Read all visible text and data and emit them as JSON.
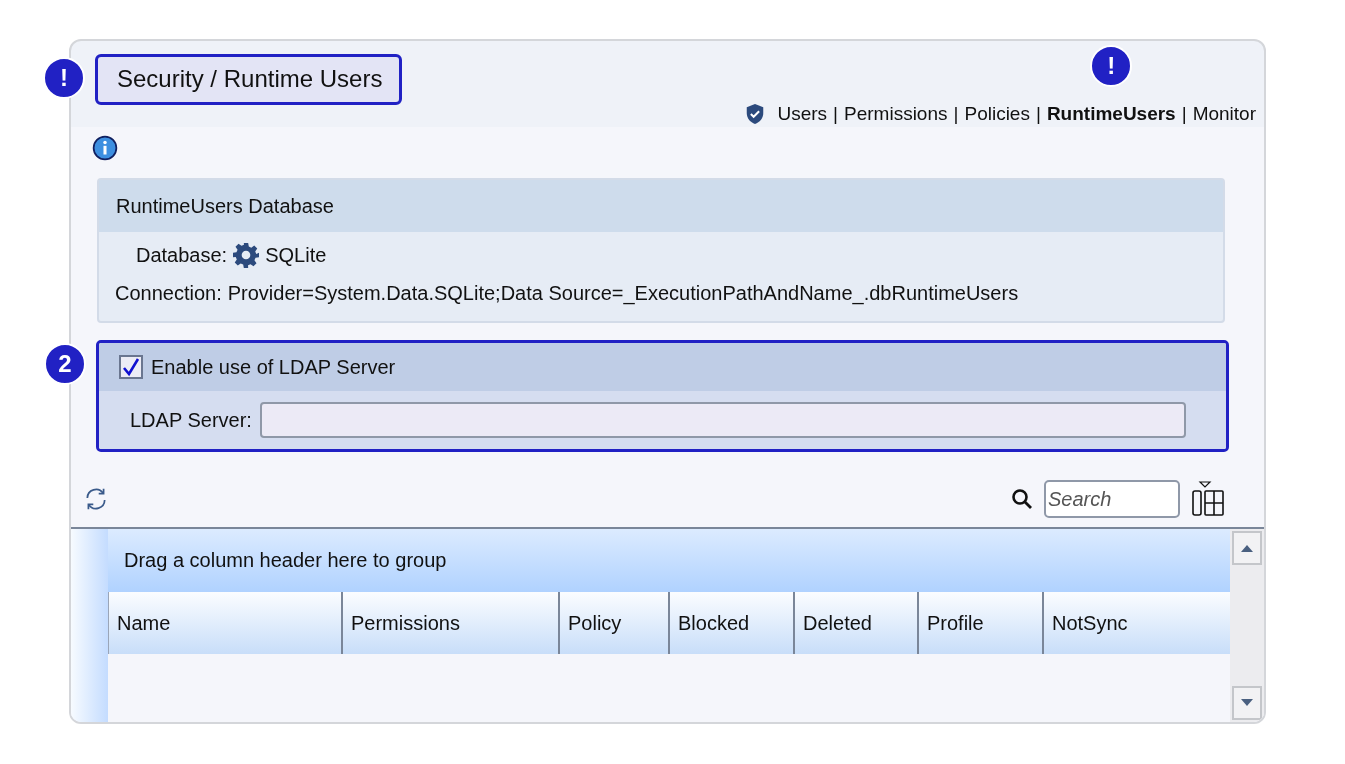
{
  "title": {
    "text": "Security / Runtime Users",
    "highlighted": true,
    "marker": "!"
  },
  "nav": [
    {
      "label": "Users",
      "selected": false
    },
    {
      "label": "Permissions",
      "selected": false
    },
    {
      "label": "Policies",
      "selected": false
    },
    {
      "label": "RuntimeUsers",
      "selected": true,
      "marker": "!"
    },
    {
      "label": "Monitor",
      "selected": false
    }
  ],
  "nav_separator": "|",
  "database_panel": {
    "title": "RuntimeUsers Database",
    "database_label": "Database:",
    "database_value": "SQLite",
    "connection_label": "Connection:",
    "connection_value": "Provider=System.Data.SQLite;Data Source=_ExecutionPathAndName_.dbRuntimeUsers"
  },
  "ldap_panel": {
    "highlighted": true,
    "marker": "2",
    "checkbox_label": "Enable use of LDAP Server",
    "checked": true,
    "server_label": "LDAP Server:"
  },
  "search": {
    "placeholder": "Search"
  },
  "grid": {
    "group_hint": "Drag a column header here to group",
    "columns": [
      "Name",
      "Permissions",
      "Policy",
      "Blocked",
      "Deleted",
      "Profile",
      "NotSync"
    ]
  }
}
